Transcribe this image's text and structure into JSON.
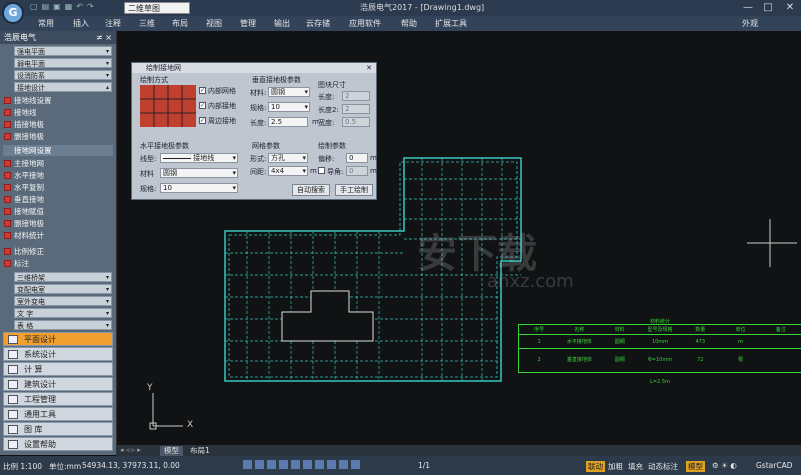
{
  "app": {
    "logo_glyph": "G",
    "view_selector": "二维草图",
    "window_title": "浩辰电气2017 - [Drawing1.dwg]",
    "appearance": "外观",
    "win_min": "—",
    "win_max": "□",
    "win_close": "✕"
  },
  "menus": [
    "常用",
    "插入",
    "注释",
    "三维",
    "布局",
    "视图",
    "管理",
    "输出",
    "云存储",
    "应用软件",
    "帮助",
    "扩展工具"
  ],
  "left_panel": {
    "title": "浩辰电气",
    "pin": "≠ ×",
    "top_subs": [
      "强电平面",
      "弱电平面",
      "设消防系",
      "接地设计"
    ],
    "tools_a": [
      "接地线设置",
      "接地线",
      "插接地极",
      "删接地极"
    ],
    "tools_b": [
      "接地网设置",
      "主接地网",
      "水平接地",
      "水平复制",
      "垂直接地",
      "接地赋值",
      "删接地极",
      "材料统计"
    ],
    "tools_c": [
      "比例修正",
      "标注"
    ],
    "bottom_subs": [
      "三维桥架",
      "变配电室",
      "室外变电",
      "文    字",
      "表    格"
    ],
    "big_buttons": [
      "平面设计",
      "系统设计",
      "计    算",
      "建筑设计",
      "工程管理",
      "通用工具",
      "图    库",
      "设置帮助"
    ]
  },
  "dialog": {
    "title": "绘制接地网",
    "close": "✕",
    "draw_mode_label": "绘制方式",
    "opt_inner_grid": "内部网格",
    "opt_inner_ground": "内部接地",
    "opt_perimeter": "周边接地",
    "vertical_params": "垂直接地极参数",
    "material_label": "材料:",
    "material_value": "圆钢",
    "spec_label": "规格:",
    "spec_value": "10",
    "length_label": "长度:",
    "length_value": "2.5",
    "unit_m": "m",
    "graphic_size": "图块尺寸",
    "len_label": "长度:",
    "len_value": "2",
    "len2_label": "长度2:",
    "len2_value": "2",
    "width_label": "宽度:",
    "width_value": "0.5",
    "horizontal_params": "水平接地极参数",
    "linetype_label": "线型:",
    "linetype_value": "接地线",
    "material2_label": "材料",
    "material2_value": "圆钢",
    "spec2_label": "规格:",
    "spec2_value": "10",
    "grid_params": "网格参数",
    "shape_label": "形式:",
    "shape_value": "方孔",
    "spacing_label": "间距:",
    "spacing_value": "4x4",
    "draw_params": "绘制参数",
    "offset_label": "偏移:",
    "offset_value": "0",
    "rotate_label": "导角:",
    "rotate_value": "0",
    "btn_auto": "自动搜索",
    "btn_manual": "手工绘制"
  },
  "table": {
    "title": "材料统计",
    "headers": [
      "序号",
      "名称",
      "材料",
      "型号及规格",
      "数量",
      "单位",
      "备注"
    ],
    "rows": [
      [
        "1",
        "水平接地体",
        "圆钢",
        "10mm",
        "473",
        "m",
        ""
      ],
      [
        "2",
        "垂直接地体",
        "圆钢",
        "Φ=10mm L=2.5m",
        "72",
        "根",
        ""
      ]
    ]
  },
  "axes": {
    "y": "Y",
    "x": "X"
  },
  "tabs": [
    "模型",
    "布局1"
  ],
  "status": {
    "scale": "比例 1:100",
    "units": "单位:mm",
    "coords": "54934.13, 37973.11, 0.00",
    "mid": "1/1",
    "right_items": [
      "联动",
      "加粗",
      "填充",
      "动态标注",
      "模型"
    ],
    "brand": "GstarCAD"
  },
  "watermark": {
    "main": "安下载",
    "sub": "anxz.com"
  },
  "colors": {
    "accent_orange": "#f0a030",
    "grid_cyan": "#39c7c0",
    "table_green": "#38d438"
  }
}
